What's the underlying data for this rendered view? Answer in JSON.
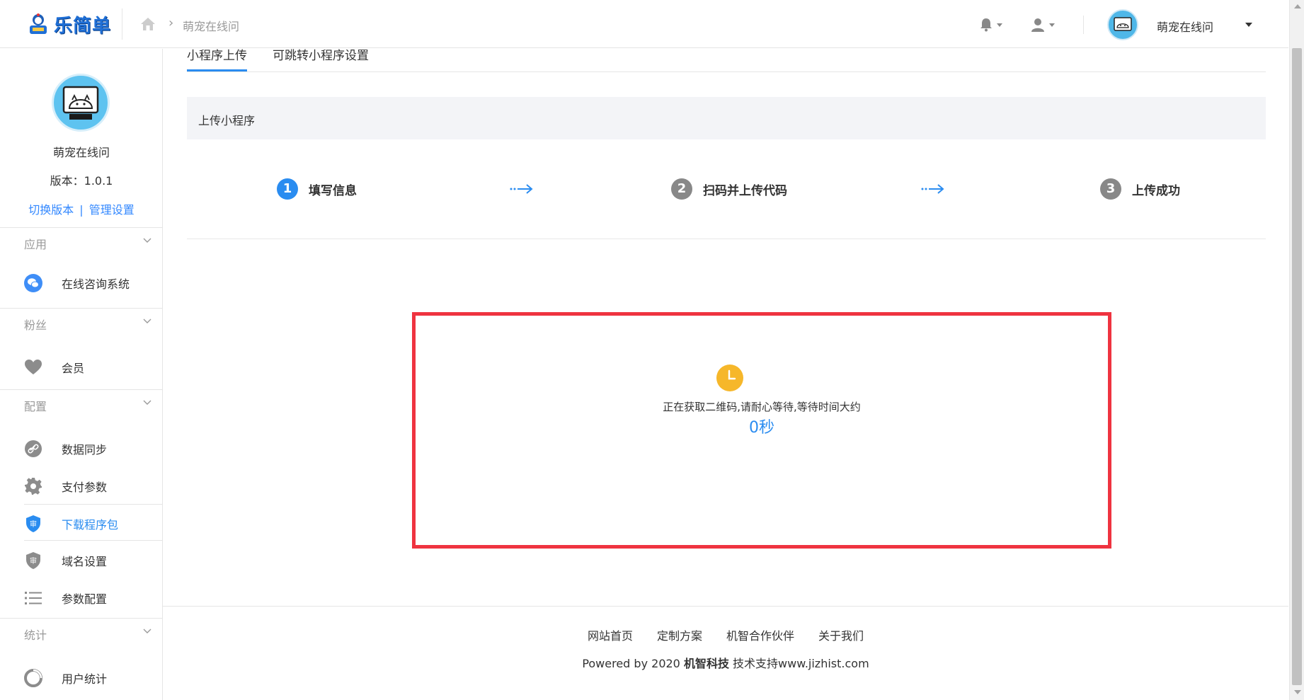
{
  "header": {
    "logo_text": "乐简单",
    "breadcrumb": "萌宠在线问",
    "username": "萌宠在线问"
  },
  "sidebar": {
    "app_name": "萌宠在线问",
    "version": "版本：1.0.1",
    "switch_version": "切换版本",
    "link_separator": "|",
    "manage_settings": "管理设置",
    "groups": [
      {
        "title": "应用",
        "items": [
          {
            "label": "在线咨询系统",
            "icon": "wechat-icon"
          }
        ]
      },
      {
        "title": "粉丝",
        "items": [
          {
            "label": "会员",
            "icon": "heart-icon"
          }
        ]
      },
      {
        "title": "配置",
        "items": [
          {
            "label": "数据同步",
            "icon": "link-icon"
          },
          {
            "label": "支付参数",
            "icon": "gear-icon"
          },
          {
            "label": "下载程序包",
            "icon": "shield-icon",
            "active": true
          },
          {
            "label": "域名设置",
            "icon": "shield-icon"
          },
          {
            "label": "参数配置",
            "icon": "list-icon"
          }
        ]
      },
      {
        "title": "统计",
        "items": [
          {
            "label": "用户统计",
            "icon": "pie-icon"
          }
        ]
      }
    ]
  },
  "main": {
    "tabs": [
      {
        "label": "小程序上传",
        "active": true
      },
      {
        "label": "可跳转小程序设置",
        "active": false
      }
    ],
    "panel_title": "上传小程序",
    "steps": [
      {
        "num": "1",
        "label": "填写信息",
        "state": "active"
      },
      {
        "num": "2",
        "label": "扫码并上传代码",
        "state": "pending"
      },
      {
        "num": "3",
        "label": "上传成功",
        "state": "pending"
      }
    ],
    "wait_message": "正在获取二维码,请耐心等待,等待时间大约",
    "wait_seconds": "0",
    "wait_unit": "秒"
  },
  "footer": {
    "links": [
      "网站首页",
      "定制方案",
      "机智合作伙伴",
      "关于我们"
    ],
    "copy_prefix": "Powered by 2020 ",
    "company": "机智科技",
    "copy_suffix": " 技术支持www.jizhist.com"
  },
  "colors": {
    "accent": "#2a8cf0",
    "step_inactive": "#888888",
    "highlight_border": "#ef3340",
    "clock": "#f6b72a"
  }
}
